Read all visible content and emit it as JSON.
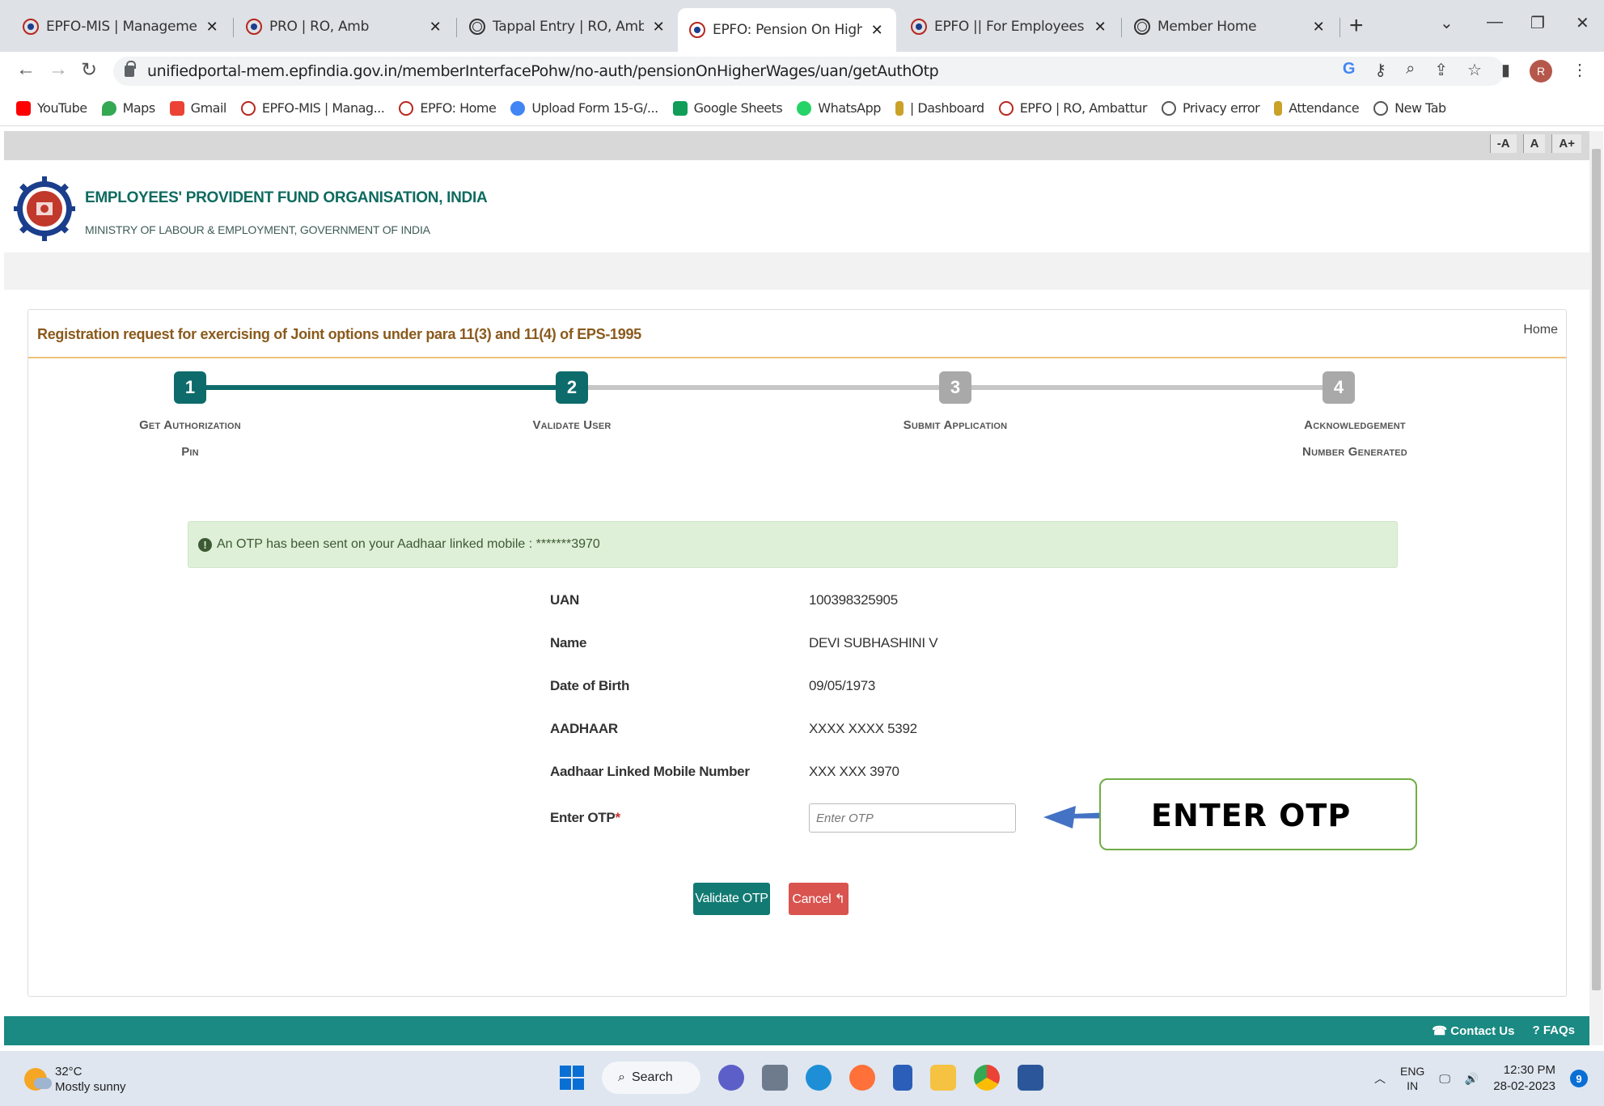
{
  "browser": {
    "tabs": [
      {
        "title": "EPFO-MIS | Management Info",
        "icon": "epfo-logo-icon"
      },
      {
        "title": "PRO | RO, Amb",
        "icon": "epfo-logo-icon"
      },
      {
        "title": "Tappal Entry | RO, Amb",
        "icon": "globe-icon"
      },
      {
        "title": "EPFO: Pension On Higher Wa",
        "icon": "epfo-logo-icon"
      },
      {
        "title": "EPFO || For Employees",
        "icon": "epfo-logo-icon"
      },
      {
        "title": "Member Home",
        "icon": "globe-icon"
      }
    ],
    "new_tab_label": "+",
    "url": "unifiedportal-mem.epfindia.gov.in/memberInterfacePohw/no-auth/pensionOnHigherWages/uan/getAuthOtp",
    "profile_initial": "R",
    "bookmarks": [
      {
        "label": "YouTube",
        "color": "#ff0000"
      },
      {
        "label": "Maps",
        "color": "#34a853"
      },
      {
        "label": "Gmail",
        "color": "#ea4335"
      },
      {
        "label": "EPFO-MIS | Manag...",
        "color": "#b5271e"
      },
      {
        "label": "EPFO: Home",
        "color": "#b5271e"
      },
      {
        "label": "Upload Form 15-G/...",
        "color": "#4285f4"
      },
      {
        "label": "Google Sheets",
        "color": "#0f9d58"
      },
      {
        "label": "WhatsApp",
        "color": "#25d366"
      },
      {
        "label": "| Dashboard",
        "color": "#c9a227"
      },
      {
        "label": "EPFO | RO, Ambattur",
        "color": "#b5271e"
      },
      {
        "label": "Privacy error",
        "color": "#555555"
      },
      {
        "label": "Attendance",
        "color": "#c9a227"
      },
      {
        "label": "New Tab",
        "color": "#555555"
      }
    ]
  },
  "accessibility": {
    "decrease": "-A",
    "normal": "A",
    "increase": "A+"
  },
  "header": {
    "org_title": "EMPLOYEES' PROVIDENT FUND ORGANISATION, INDIA",
    "org_subtitle": "MINISTRY OF LABOUR & EMPLOYMENT, GOVERNMENT OF INDIA"
  },
  "panel": {
    "title": "Registration request for exercising of Joint options under para 11(3) and 11(4) of EPS-1995",
    "home_link": "Home"
  },
  "steps": [
    {
      "num": "1",
      "label_line1": "Get Authorization",
      "label_line2": "Pin",
      "state": "done"
    },
    {
      "num": "2",
      "label_line1": "Validate User",
      "label_line2": "",
      "state": "done"
    },
    {
      "num": "3",
      "label_line1": "Submit Application",
      "label_line2": "",
      "state": "todo"
    },
    {
      "num": "4",
      "label_line1": "Acknowledgement",
      "label_line2": "Number Generated",
      "state": "todo"
    }
  ],
  "alert": {
    "icon": "exclamation-circle-icon",
    "text": "An OTP has been sent on your Aadhaar linked mobile : *******3970"
  },
  "details": [
    {
      "label": "UAN",
      "value": "100398325905"
    },
    {
      "label": "Name",
      "value": "DEVI SUBHASHINI V"
    },
    {
      "label": "Date of Birth",
      "value": "09/05/1973"
    },
    {
      "label": "AADHAAR",
      "value": "XXXX XXXX 5392"
    },
    {
      "label": "Aadhaar Linked Mobile Number",
      "value": "XXX XXX 3970"
    }
  ],
  "otp": {
    "label": "Enter OTP",
    "required_mark": "*",
    "placeholder": "Enter OTP",
    "value": ""
  },
  "buttons": {
    "validate": "Validate OTP",
    "cancel": "Cancel"
  },
  "annotation": {
    "text": "ENTER OTP",
    "border_color": "#70ad47",
    "arrow_color": "#4472c4"
  },
  "footer": {
    "contact": "Contact Us",
    "faqs": "FAQs"
  },
  "taskbar": {
    "temperature": "32°C",
    "weather": "Mostly sunny",
    "search_label": "Search",
    "lang_line1": "ENG",
    "lang_line2": "IN",
    "time": "12:30 PM",
    "date": "28-02-2023",
    "notifications": "9"
  },
  "colors": {
    "primary": "#0e6b6b",
    "accent": "#8a5a1c",
    "footer": "#1a8a82",
    "cancel": "#d9534f"
  }
}
